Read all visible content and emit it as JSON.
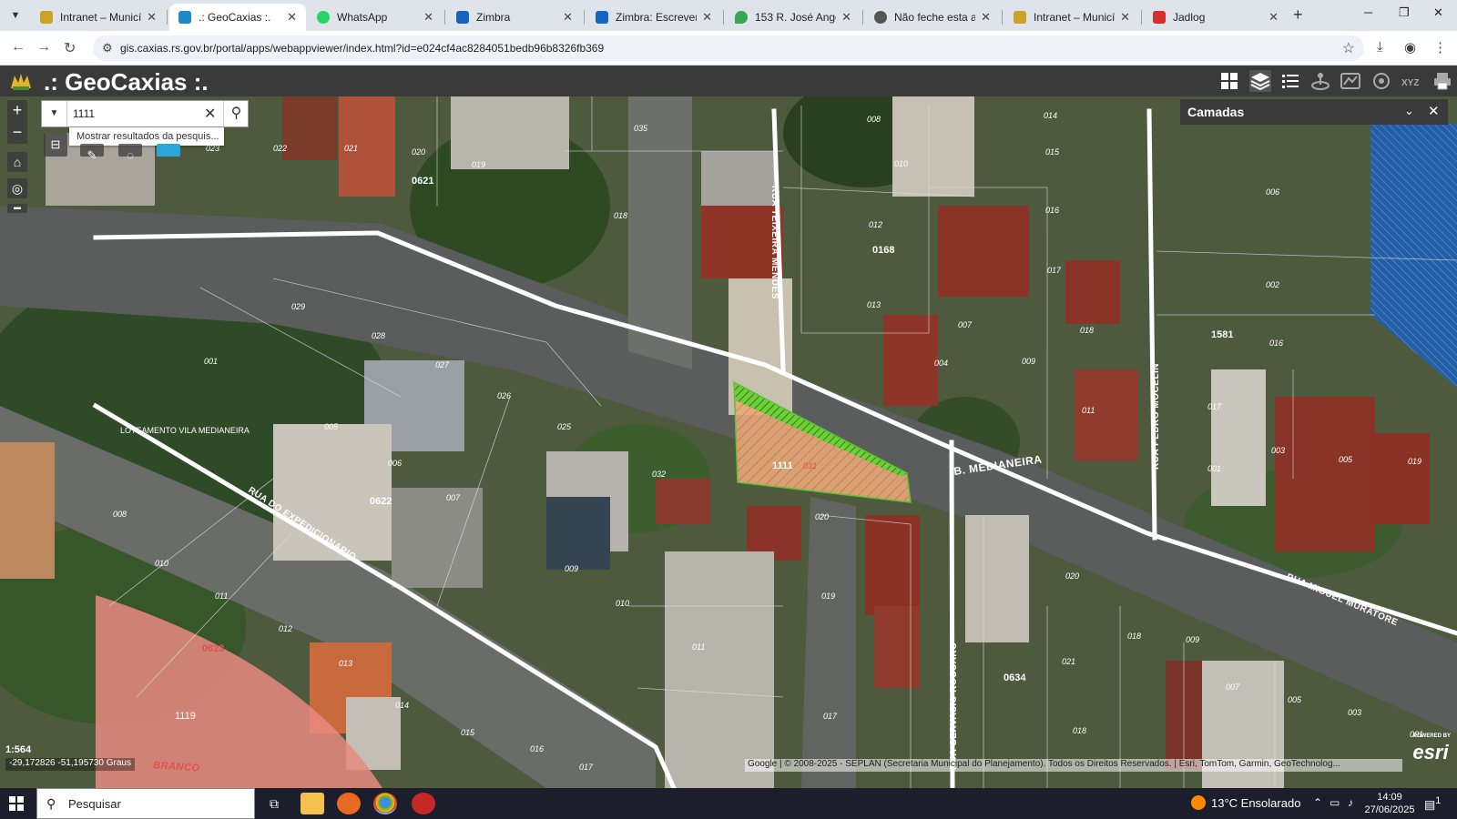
{
  "browser": {
    "tabs": [
      {
        "label": "Intranet – Município d",
        "icon": "intranet-favicon",
        "color": "#c9a227"
      },
      {
        "label": ".: GeoCaxias :.",
        "icon": "webappviewer-favicon",
        "color": "#1e88c8",
        "active": true
      },
      {
        "label": "WhatsApp",
        "icon": "whatsapp-favicon",
        "color": "#25d366"
      },
      {
        "label": "Zimbra",
        "icon": "zimbra-favicon",
        "color": "#1565c0"
      },
      {
        "label": "Zimbra: Escrever",
        "icon": "zimbra-compose-favicon",
        "color": "#1565c0"
      },
      {
        "label": "153 R. José Angeli - C",
        "icon": "maps-pin-favicon",
        "color": "#34a853"
      },
      {
        "label": "Não feche esta aba! A",
        "icon": "globe-favicon",
        "color": "#555555"
      },
      {
        "label": "Intranet – Município d",
        "icon": "intranet-favicon",
        "color": "#c9a227"
      },
      {
        "label": "Jadlog",
        "icon": "jadlog-favicon",
        "color": "#d32f2f"
      }
    ],
    "url": "gis.caxias.rs.gov.br/portal/apps/webappviewer/index.html?id=e024cf4ac8284051bedb96b8326fb369"
  },
  "app": {
    "title": ".: GeoCaxias :.",
    "header_icons": [
      "basemap-gallery-icon",
      "layers-icon",
      "legend-list-icon",
      "measure-icon",
      "overview-map-icon",
      "select-icon",
      "coordinate-xyz-icon",
      "print-icon"
    ],
    "accent": "#3a3a3a"
  },
  "search": {
    "value": "1111",
    "suggestion": "Mostrar resultados da pesquis..."
  },
  "layers_panel": {
    "title": "Camadas"
  },
  "map": {
    "streets": [
      "RUA TEIXEIRA MENDES",
      "B. MEDIANEIRA",
      "RUA PEDRO MOCELIN",
      "RUA DO EXPEDICIONARIO",
      "RUA MIGUEL MURATORE",
      "RUA GERVASIO ROCCARO",
      "BRANCO"
    ],
    "area_label": "LOTEAMENTO VILA MEDIANEIRA",
    "blocks": [
      "0621",
      "0168",
      "1581",
      "0622",
      "0623",
      "0634",
      "1119"
    ],
    "selected_parcel": {
      "block": "1111",
      "lot": "031",
      "fill": "#e8a878",
      "outline": "#5ec13a"
    },
    "lots": [
      "035",
      "022",
      "021",
      "020",
      "019",
      "023",
      "018",
      "008",
      "014",
      "015",
      "010",
      "016",
      "012",
      "017",
      "013",
      "007",
      "009",
      "018",
      "011",
      "017",
      "006",
      "002",
      "016",
      "003",
      "001",
      "005",
      "019",
      "029",
      "028",
      "027",
      "001",
      "026",
      "005",
      "006",
      "007",
      "025",
      "032",
      "031",
      "020",
      "008",
      "009",
      "010",
      "011",
      "012",
      "013",
      "014",
      "015",
      "016",
      "017",
      "019",
      "020",
      "021",
      "018",
      "009",
      "007",
      "005",
      "003",
      "001",
      "004",
      "010",
      "011",
      "017",
      "018"
    ],
    "scale": "1:564",
    "coordinates": "-29,172826 -51,195730 Graus",
    "attribution": "Google | © 2008-2025 - SEPLAN (Secretaria Municipal do Planejamento). Todos os Direitos Reservados. | Esri, TomTom, Garmin, GeoTechnolog...",
    "esri_small": "POWERED BY",
    "esri": "esri"
  },
  "taskbar": {
    "search_placeholder": "Pesquisar",
    "weather": "13°C  Ensolarado",
    "time": "14:09",
    "date": "27/06/2025",
    "notifications": "1"
  }
}
